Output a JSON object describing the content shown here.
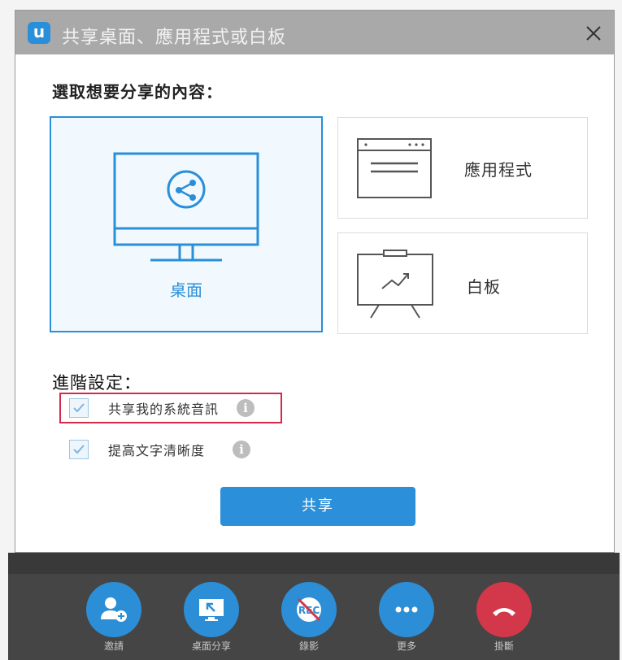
{
  "dialog": {
    "title": "共享桌面、應用程式或白板",
    "logo_letter": "u",
    "prompt": "選取想要分享的內容：",
    "options": [
      {
        "label": "桌面",
        "selected": true
      },
      {
        "label": "應用程式",
        "selected": false
      },
      {
        "label": "白板",
        "selected": false
      }
    ],
    "advanced": {
      "heading": "進階設定：",
      "settings": [
        {
          "label": "共享我的系統音訊",
          "checked": true,
          "highlighted": true
        },
        {
          "label": "提高文字清晰度",
          "checked": true,
          "highlighted": false
        }
      ]
    },
    "share_button": "共享"
  },
  "toolbar": {
    "items": [
      {
        "label": "邀請",
        "icon": "add-user-icon"
      },
      {
        "label": "桌面分享",
        "icon": "screen-share-icon"
      },
      {
        "label": "錄影",
        "icon": "record-disabled-icon"
      },
      {
        "label": "更多",
        "icon": "more-icon"
      },
      {
        "label": "掛斷",
        "icon": "hang-up-icon"
      }
    ]
  },
  "colors": {
    "accent": "#2a8fd9",
    "highlight_border": "#d42a4a",
    "hangup": "#d3374a",
    "titlebar": "#a9a9a9"
  }
}
